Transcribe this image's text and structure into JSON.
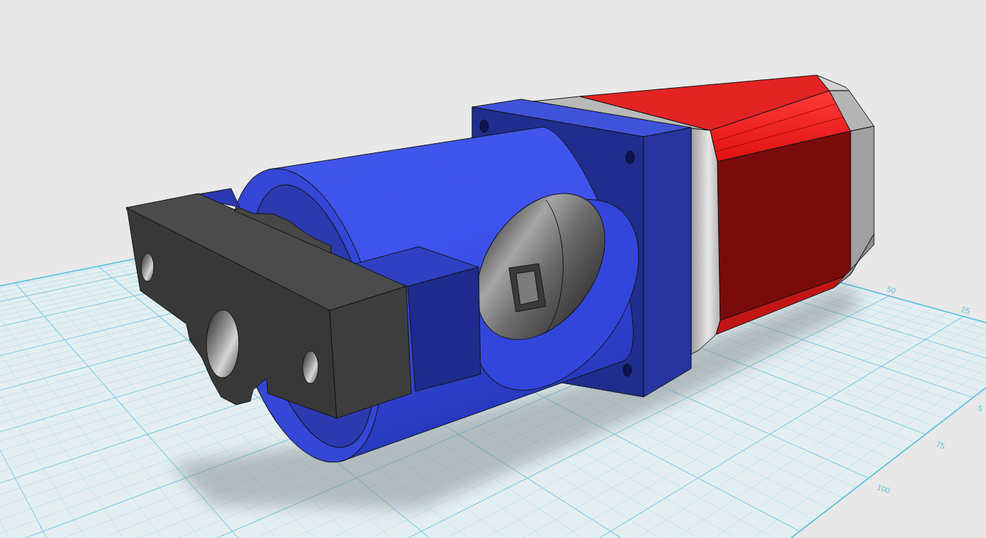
{
  "workplane": {
    "far_edge_labels": [
      "50",
      "25"
    ],
    "near_edge_labels": [
      "5",
      "75",
      "100"
    ]
  }
}
